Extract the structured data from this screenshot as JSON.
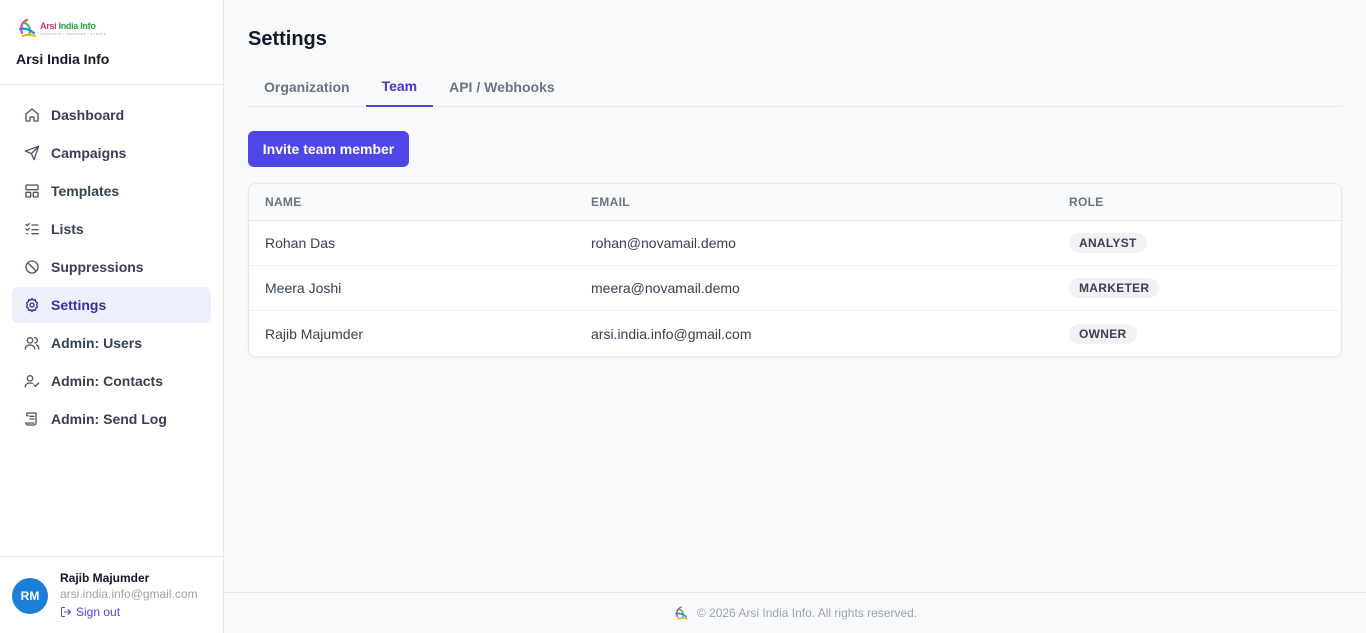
{
  "brand": {
    "logo_text_a": "Arsi ",
    "logo_text_b": "India Info",
    "logo_tagline": "PRODUCTS • SERVICES • EVENTS",
    "name": "Arsi India Info"
  },
  "sidebar": {
    "items": [
      {
        "label": "Dashboard",
        "icon": "home-icon"
      },
      {
        "label": "Campaigns",
        "icon": "send-icon"
      },
      {
        "label": "Templates",
        "icon": "layout-icon"
      },
      {
        "label": "Lists",
        "icon": "list-check-icon"
      },
      {
        "label": "Suppressions",
        "icon": "ban-icon"
      },
      {
        "label": "Settings",
        "icon": "gear-icon",
        "active": true
      },
      {
        "label": "Admin: Users",
        "icon": "users-icon"
      },
      {
        "label": "Admin: Contacts",
        "icon": "user-check-icon"
      },
      {
        "label": "Admin: Send Log",
        "icon": "scroll-icon"
      }
    ]
  },
  "user": {
    "initials": "RM",
    "name": "Rajib Majumder",
    "email": "arsi.india.info@gmail.com",
    "signout_label": "Sign out"
  },
  "page": {
    "title": "Settings",
    "tabs": [
      {
        "label": "Organization"
      },
      {
        "label": "Team",
        "active": true
      },
      {
        "label": "API / Webhooks"
      }
    ],
    "invite_label": "Invite team member"
  },
  "table": {
    "headers": [
      "NAME",
      "EMAIL",
      "ROLE"
    ],
    "rows": [
      {
        "name": "Rohan Das",
        "email": "rohan@novamail.demo",
        "role": "ANALYST"
      },
      {
        "name": "Meera Joshi",
        "email": "meera@novamail.demo",
        "role": "MARKETER"
      },
      {
        "name": "Rajib Majumder",
        "email": "arsi.india.info@gmail.com",
        "role": "OWNER"
      }
    ]
  },
  "footer": {
    "text": "© 2026 Arsi India Info. All rights reserved."
  },
  "colors": {
    "accent": "#4f46e5",
    "active_nav_bg": "#eef0fb",
    "avatar_bg": "#1d7ed6"
  }
}
